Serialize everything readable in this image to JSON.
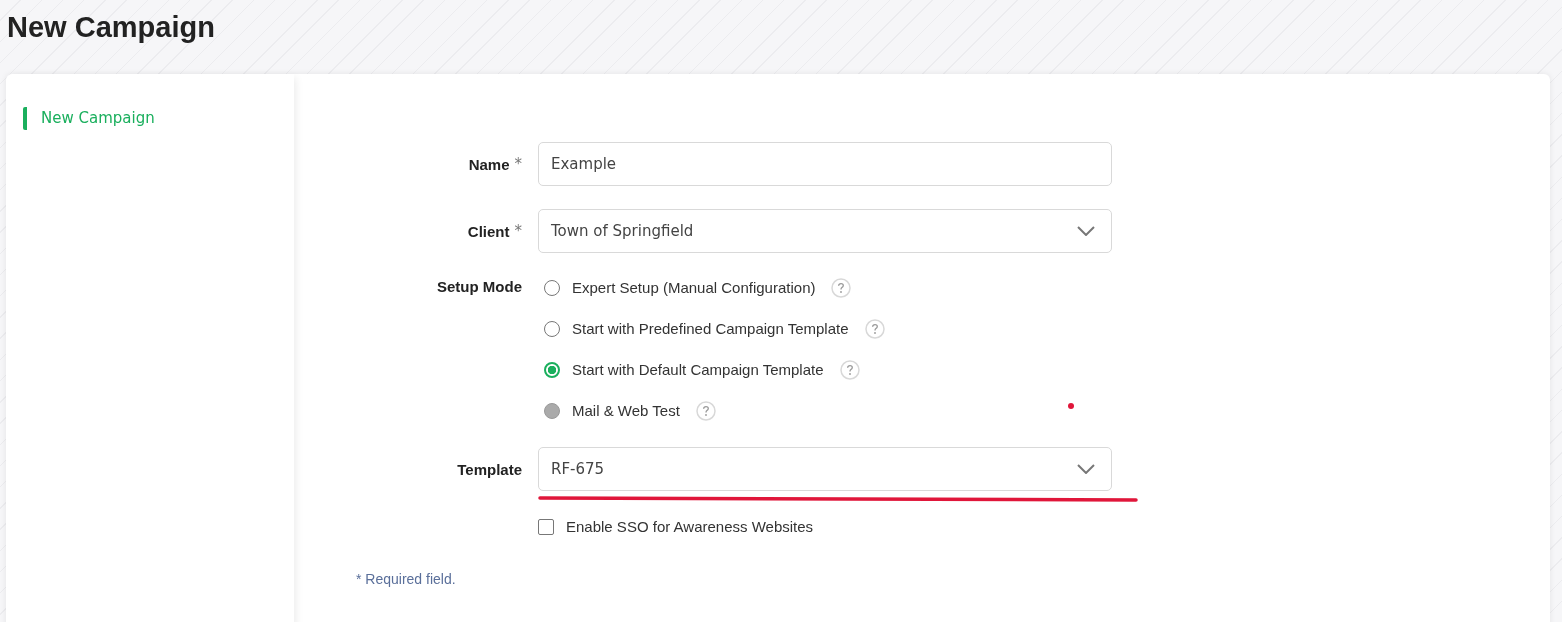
{
  "page_title": "New Campaign",
  "sidebar": {
    "items": [
      {
        "label": "New Campaign",
        "selected": true
      }
    ]
  },
  "form": {
    "rows": [
      {
        "kind": "text",
        "label": "Name",
        "required_mark": "*",
        "value": "Example"
      },
      {
        "kind": "select",
        "label": "Client",
        "required_mark": "*",
        "value": "Town of Springfield"
      },
      {
        "kind": "radio",
        "label": "Setup Mode",
        "options": [
          {
            "label": "Expert Setup (Manual Configuration)",
            "selected": false,
            "disabled": false
          },
          {
            "label": "Start with Predefined Campaign Template",
            "selected": false,
            "disabled": false
          },
          {
            "label": "Start with Default Campaign Template",
            "selected": true,
            "disabled": false
          },
          {
            "label": "Mail & Web Test",
            "selected": false,
            "disabled": true
          }
        ]
      },
      {
        "kind": "select",
        "label": "Template",
        "value": "RF-675"
      }
    ],
    "sso_checkbox": {
      "label": "Enable SSO for Awareness Websites",
      "checked": false
    },
    "required_note": "* Required field."
  }
}
